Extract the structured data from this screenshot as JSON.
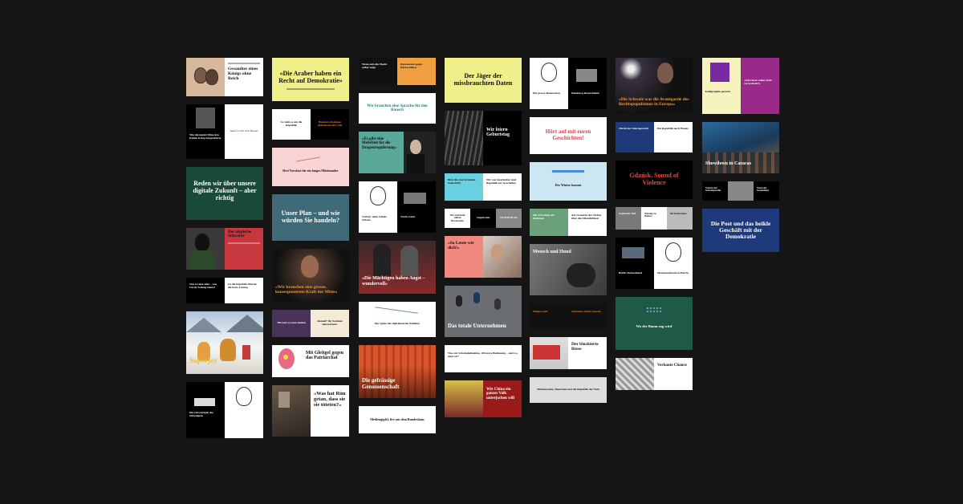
{
  "cards": {
    "c1_1": "Gesandter eines Königs ohne Reich",
    "c1_2": "Jeder ist für sich Diener",
    "c1_2b": "Wie Alexander Dinu den Kalten Krieg fotografierte",
    "c1_3": "Reden wir über unsere digitale Zukunft – aber richtig",
    "c1_4": "Der atypische Schwarze",
    "c1_5a": "Was ist eine Idee – was Cardy Sedang Ideen?",
    "c1_5b": "Ist die Republik überall die beste Lösung",
    "c1_6": "Superjoy",
    "c1_7": "Die Schwierigen des Schweigens",
    "c2_1": "«Die Araber haben ein Recht auf Demokratie»",
    "c2_2a": "So steht es um die Republik",
    "c2_2b": "Hunderte Kollegen diskutieren fürs Ziel",
    "c2_3": "Drei Vorsätze für ein langes Miteinander",
    "c2_4": "Unser Plan – und wie würden Sie handeln?",
    "c2_5": "«Wir brauchen eine grosse, konsequentente Kraft der Mitte»",
    "c2_6a": "Tilt und wo man landen",
    "c2_6b": "Aktuell? Ihr Seminar inkonsistent.",
    "c2_7": "Mit Gleitgel gegen das Patriarchat",
    "c2_8": "«Was hat Rim getan, dass sie sie töteten?»",
    "c3_1a": "Wenn sich die Macht selber zeigt",
    "c3_1b": "Demokratie gegen Rückschlüsse",
    "c3_2": "Wir brauchen eine Sprache für den Rausch",
    "c3_3": "«Es gibt eine Mehrheit für die Drogenregulierung»",
    "c3_4a": "Verlegt: ohne Schule Schriet",
    "c3_4b": "Vernis Ainsi",
    "c3_5": "«Die Mächtigen haben Angst – wundervoll»",
    "c3_6": "Die Spitze der digitalisierten Politiker",
    "c3_7": "Die gefrässige Genossenschaft",
    "c3_8": "Mediengipfel, live aus dem Bundeshaus",
    "c4_1": "Der Jäger der missbrauchten Daten",
    "c4_2": "Wir feiern Geburtstag",
    "c4_3a": "Bitte die eine Kriminal-Zeitschrift",
    "c4_3b": "Wir von Interkultur sind Republik zur Geschichte",
    "c4_4a": "Wie wird Kein Aktion Bewusstsein",
    "c4_4b": "Ausgebrannt",
    "c4_4c": "Ein Brief für das",
    "c4_5": "«So Leute wie dich!»",
    "c4_6": "Das totale Unternehmen",
    "c4_7": "Was zur Schwindelmahlen, 100 extra Bedienung – und wo sind wir?",
    "c4_8": "Wie China ein ganzes Volk unterjochen will",
    "c5_1a": "Die grosse Moderation",
    "c5_1b": "Hamburg-Deutschland",
    "c5_2": "Hört auf mit euren Geschichten!",
    "c5_3": "Der Winter kommt",
    "c5_4a": "Mit Vorschlag der Mehrheit",
    "c5_4b": "Am Grund in der Tiefsee über die Öffentlichkeit",
    "c5_5": "Mensch und Hund",
    "c5_6a": "Wahres und",
    "c5_6b": "Schweizer Sucht Gesetze",
    "c5_7": "Der blockierte Riese",
    "c5_8": "Mitmenschen, Menschen und die Republik der Welt",
    "c6_1": "«Die Schweiz war die Avantgarde des Rechtspopulismus in Europa»",
    "c6_2a": "Zürich im Gleichgewicht",
    "c6_2b": "Die Republik nach Monat",
    "c6_3": "Gdańsk, Sound of Violence",
    "c6_4a": "Kapital der Welt",
    "c6_4b": "Nieming zu Bunnos",
    "c6_4c": "Die Daten heute",
    "c6_5a": "Berlin-Deutschland",
    "c6_5b": "Metamorphosen in Barrio",
    "c6_6": "Wo der Baum eng wird",
    "c6_7": "Verbaute Chance",
    "c7_1a": "Kalligraphie gerecht",
    "c7_1b": "«Schweizer sollen nicht verwechselt?»",
    "c7_2": "Showdown in Caracas",
    "c7_3a": "Warum der Schwiegersohn",
    "c7_3b": "Wenn der Sorgenkind",
    "c7_4": "Die Post und das heikle Geschäft mit der Demokratie"
  },
  "colors": {
    "background": "#151515",
    "accent_red": "#c8363e",
    "accent_yellow": "#f0f08a",
    "accent_green": "#1c4a39"
  }
}
